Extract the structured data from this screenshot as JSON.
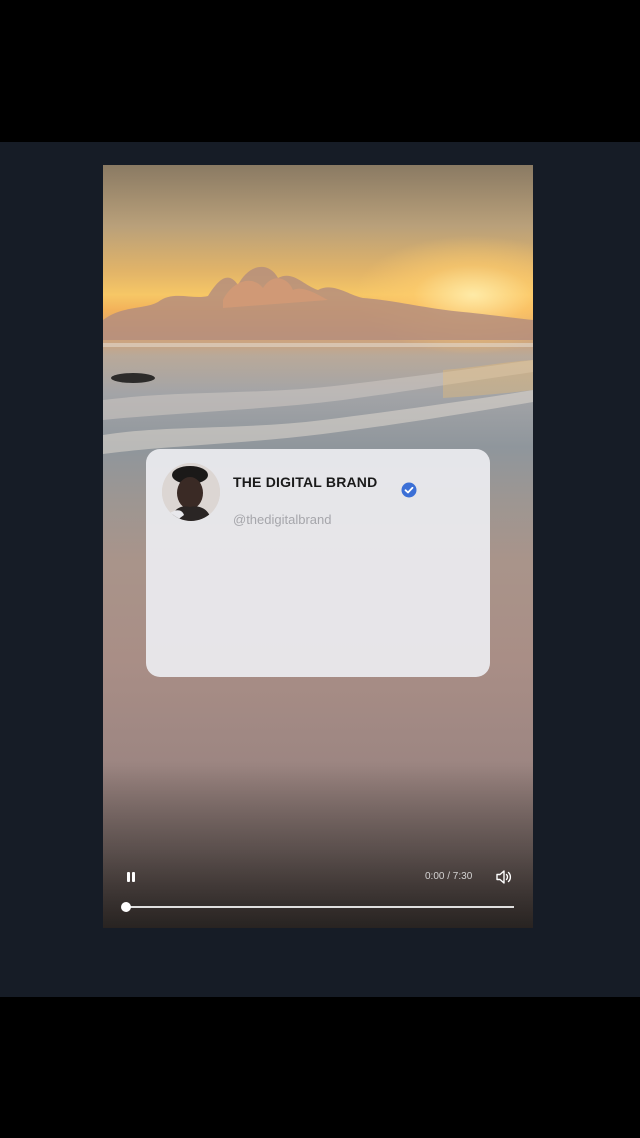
{
  "profile": {
    "name": "THE DIGITAL BRAND",
    "handle": "@thedigitalbrand",
    "verified_icon": "verified-check-icon",
    "verified_color": "#3b6fd6"
  },
  "player": {
    "time": "0:00 / 7:30",
    "progress": 0,
    "pause_icon": "pause-icon",
    "volume_icon": "volume-icon"
  },
  "colors": {
    "backdrop": "#161c26",
    "letterbox": "#000000"
  }
}
